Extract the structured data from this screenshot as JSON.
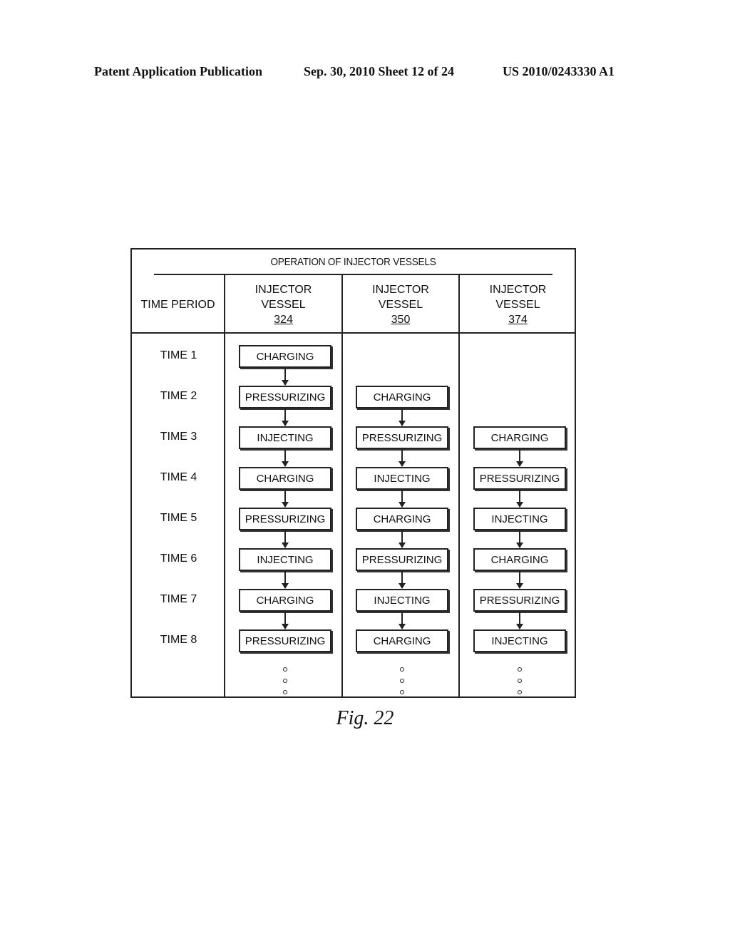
{
  "header": {
    "left": "Patent Application Publication",
    "middle": "Sep. 30, 2010   Sheet 12 of 24",
    "right": "US 2010/0243330 A1"
  },
  "table": {
    "title": "OPERATION OF INJECTOR VESSELS",
    "time_header": "TIME PERIOD",
    "columns": [
      {
        "line1": "INJECTOR",
        "line2": "VESSEL",
        "ref": "324",
        "start": 0,
        "states": [
          "CHARGING",
          "PRESSURIZING",
          "INJECTING",
          "CHARGING",
          "PRESSURIZING",
          "INJECTING",
          "CHARGING",
          "PRESSURIZING"
        ]
      },
      {
        "line1": "INJECTOR",
        "line2": "VESSEL",
        "ref": "350",
        "start": 1,
        "states": [
          "CHARGING",
          "PRESSURIZING",
          "INJECTING",
          "CHARGING",
          "PRESSURIZING",
          "INJECTING",
          "CHARGING"
        ]
      },
      {
        "line1": "INJECTOR",
        "line2": "VESSEL",
        "ref": "374",
        "start": 2,
        "states": [
          "CHARGING",
          "PRESSURIZING",
          "INJECTING",
          "CHARGING",
          "PRESSURIZING",
          "INJECTING"
        ]
      }
    ],
    "times": [
      "TIME 1",
      "TIME 2",
      "TIME 3",
      "TIME 4",
      "TIME 5",
      "TIME 6",
      "TIME 7",
      "TIME 8"
    ],
    "continuation": "ellipsis-dots"
  },
  "figure_caption": "Fig. 22"
}
